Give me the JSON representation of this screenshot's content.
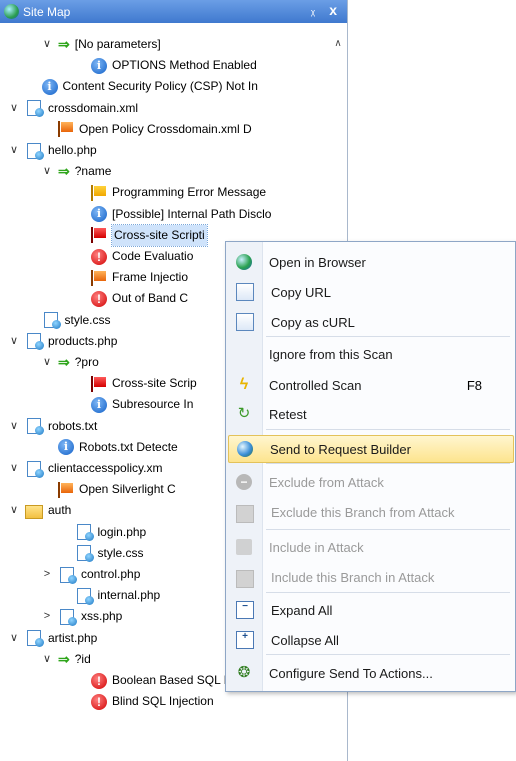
{
  "panel": {
    "title": "Site Map",
    "pin_glyph": "ᵪ",
    "close_glyph": "x"
  },
  "tree": [
    {
      "label": "[No parameters]",
      "indent": 2,
      "chev": "∨",
      "icon": "arrow"
    },
    {
      "label": "OPTIONS Method Enabled",
      "indent": 4,
      "icon": "info"
    },
    {
      "label": "Content Security Policy (CSP) Not In",
      "indent": 1,
      "icon": "info"
    },
    {
      "label": "crossdomain.xml",
      "indent": 0,
      "chev": "∨",
      "icon": "file"
    },
    {
      "label": "Open Policy Crossdomain.xml D",
      "indent": 2,
      "icon": "flag-o"
    },
    {
      "label": "hello.php",
      "indent": 0,
      "chev": "∨",
      "icon": "file"
    },
    {
      "label": "?name",
      "indent": 2,
      "chev": "∨",
      "icon": "arrow"
    },
    {
      "label": "Programming Error Message",
      "indent": 4,
      "icon": "flag-y"
    },
    {
      "label": "[Possible] Internal Path Disclo",
      "indent": 4,
      "icon": "info"
    },
    {
      "label": "Cross-site Scripti",
      "indent": 4,
      "icon": "flag-r",
      "selected": true
    },
    {
      "label": "Code Evaluatio",
      "indent": 4,
      "icon": "crit"
    },
    {
      "label": "Frame Injectio",
      "indent": 4,
      "icon": "flag-o"
    },
    {
      "label": "Out of Band C",
      "indent": 4,
      "icon": "crit"
    },
    {
      "label": "style.css",
      "indent": 1,
      "icon": "file"
    },
    {
      "label": "products.php",
      "indent": 0,
      "chev": "∨",
      "icon": "file"
    },
    {
      "label": "?pro",
      "indent": 2,
      "chev": "∨",
      "icon": "arrow"
    },
    {
      "label": "Cross-site Scrip",
      "indent": 4,
      "icon": "flag-r"
    },
    {
      "label": "Subresource In",
      "indent": 4,
      "icon": "info"
    },
    {
      "label": "robots.txt",
      "indent": 0,
      "chev": "∨",
      "icon": "file"
    },
    {
      "label": "Robots.txt Detecte",
      "indent": 2,
      "icon": "info"
    },
    {
      "label": "clientaccesspolicy.xm",
      "indent": 0,
      "chev": "∨",
      "icon": "file"
    },
    {
      "label": "Open Silverlight C",
      "indent": 2,
      "icon": "flag-o"
    },
    {
      "label": "auth",
      "indent": 0,
      "chev": "∨",
      "icon": "folder"
    },
    {
      "label": "login.php",
      "indent": 3,
      "icon": "file"
    },
    {
      "label": "style.css",
      "indent": 3,
      "icon": "file"
    },
    {
      "label": "control.php",
      "indent": 2,
      "chev": ">",
      "icon": "file"
    },
    {
      "label": "internal.php",
      "indent": 3,
      "icon": "file"
    },
    {
      "label": "xss.php",
      "indent": 2,
      "chev": ">",
      "icon": "file"
    },
    {
      "label": "artist.php",
      "indent": 0,
      "chev": "∨",
      "icon": "file"
    },
    {
      "label": "?id",
      "indent": 2,
      "chev": "∨",
      "icon": "arrow"
    },
    {
      "label": "Boolean Based SQL Injection",
      "indent": 4,
      "icon": "crit"
    },
    {
      "label": "Blind SQL Injection",
      "indent": 4,
      "icon": "crit"
    }
  ],
  "menu": {
    "items": [
      {
        "label": "Open in Browser",
        "icon": "globe-icon",
        "enabled": true
      },
      {
        "label": "Copy URL",
        "icon": "copy-icon",
        "enabled": true
      },
      {
        "label": "Copy as cURL",
        "icon": "copy-icon",
        "enabled": true
      },
      {
        "label": "Ignore from this Scan",
        "icon": "",
        "enabled": true
      },
      {
        "label": "Controlled Scan",
        "icon": "bolt-icon",
        "enabled": true,
        "shortcut": "F8"
      },
      {
        "label": "Retest",
        "icon": "retest-icon",
        "enabled": true
      },
      {
        "label": "Send to Request Builder",
        "icon": "send-icon",
        "enabled": true,
        "highlighted": true
      },
      {
        "label": "Exclude from Attack",
        "icon": "exclude-icon",
        "enabled": false
      },
      {
        "label": "Exclude this Branch from Attack",
        "icon": "exclude-branch-icon",
        "enabled": false
      },
      {
        "label": "Include in Attack",
        "icon": "include-icon",
        "enabled": false
      },
      {
        "label": "Include this Branch in Attack",
        "icon": "include-branch-icon",
        "enabled": false
      },
      {
        "label": "Expand All",
        "icon": "expand-icon",
        "enabled": true
      },
      {
        "label": "Collapse All",
        "icon": "collapse-icon",
        "enabled": true
      },
      {
        "label": "Configure Send To Actions...",
        "icon": "bug-icon",
        "enabled": true
      }
    ]
  }
}
